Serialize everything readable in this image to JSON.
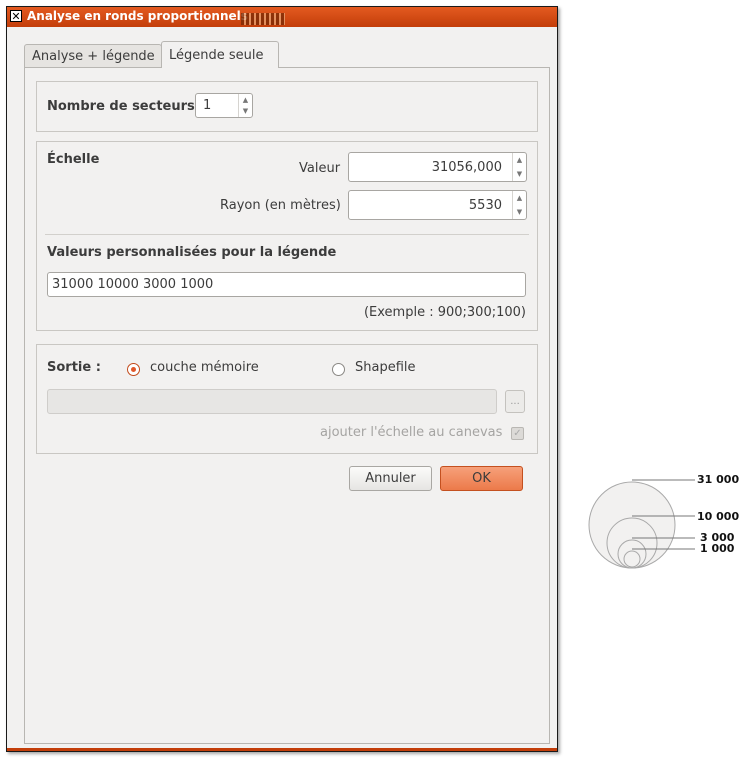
{
  "window": {
    "title": "Analyse en ronds proportionnels",
    "close_glyph": "✕"
  },
  "tabs": [
    {
      "label": "Analyse + légende"
    },
    {
      "label": "Légende seule"
    }
  ],
  "sectors": {
    "label": "Nombre de secteurs",
    "value": "1"
  },
  "scale": {
    "heading": "Échelle",
    "value_label": "Valeur",
    "value": "31056,000",
    "radius_label": "Rayon (en mètres)",
    "radius": "5530"
  },
  "custom_values": {
    "heading": "Valeurs personnalisées pour la légende",
    "input_value": "31000 10000 3000 1000",
    "example": "(Exemple : 900;300;100)"
  },
  "output": {
    "label": "Sortie :",
    "option_memory": "couche mémoire",
    "option_shapefile": "Shapefile",
    "selected": "couche mémoire",
    "path_value": "",
    "browse_label": "...",
    "add_scale_label": "ajouter l'échelle au canevas",
    "add_scale_checked": true
  },
  "buttons": {
    "cancel": "Annuler",
    "ok": "OK"
  },
  "legend": {
    "labels": [
      "31 000",
      "10 000",
      "3 000",
      "1 000"
    ]
  }
}
